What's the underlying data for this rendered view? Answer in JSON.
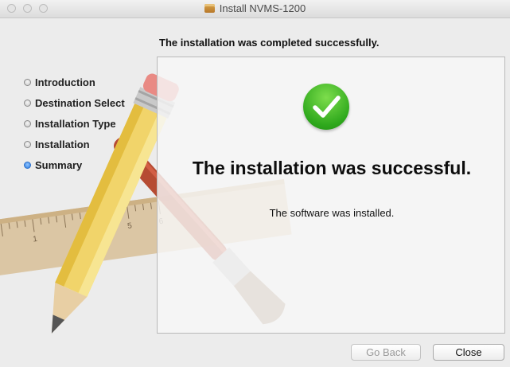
{
  "window": {
    "title": "Install NVMS-1200"
  },
  "header": {
    "status_text": "The installation was completed successfully."
  },
  "sidebar": {
    "steps": [
      {
        "label": "Introduction",
        "active": false
      },
      {
        "label": "Destination Select",
        "active": false
      },
      {
        "label": "Installation Type",
        "active": false
      },
      {
        "label": "Installation",
        "active": false
      },
      {
        "label": "Summary",
        "active": true
      }
    ]
  },
  "main": {
    "title": "The installation was successful.",
    "message": "The software was installed."
  },
  "buttons": {
    "go_back": "Go Back",
    "close": "Close"
  },
  "icons": {
    "success": "checkmark-circle-icon",
    "package": "package-icon"
  },
  "colors": {
    "success_green": "#2ea81c",
    "active_step_blue": "#2d7ae0"
  }
}
